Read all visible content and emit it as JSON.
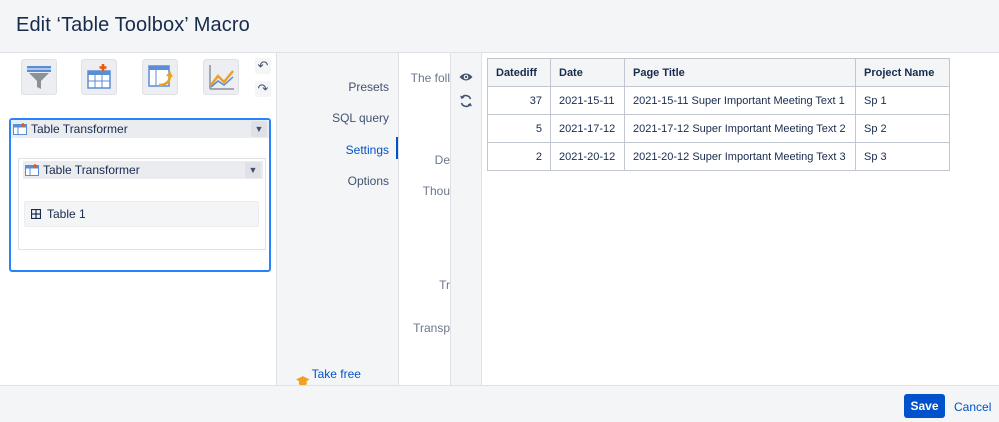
{
  "dialog": {
    "title": "Edit ‘Table Toolbox’ Macro"
  },
  "toolbar": {
    "tools": [
      {
        "icon": "filter-funnel-icon"
      },
      {
        "icon": "table-add-icon"
      },
      {
        "icon": "table-pivot-icon"
      },
      {
        "icon": "chart-line-icon"
      }
    ],
    "undo_icon": "undo-icon",
    "redo_icon": "redo-icon"
  },
  "macro_tree": {
    "outer_label": "Table Transformer",
    "inner_label": "Table Transformer",
    "table_label": "Table 1"
  },
  "nav": {
    "items": [
      "Presets",
      "SQL query",
      "Settings",
      "Options"
    ],
    "active": "Settings",
    "course_link": "Take free course"
  },
  "settings_fragments": [
    "The foll",
    "De",
    "Thou",
    "Tr",
    "Transp"
  ],
  "preview_controls": {
    "preview_icon": "eye-icon",
    "refresh_icon": "refresh-icon"
  },
  "preview_table": {
    "columns": [
      "Datediff",
      "Date",
      "Page Title",
      "Project Name"
    ],
    "rows": [
      [
        "37",
        "2021-15-11",
        "2021-15-11 Super Important Meeting Text 1",
        "Sp 1"
      ],
      [
        "5",
        "2021-17-12",
        "2021-17-12 Super Important Meeting Text 2",
        "Sp 2"
      ],
      [
        "2",
        "2021-20-12",
        "2021-20-12 Super Important Meeting Text 3",
        "Sp 3"
      ]
    ]
  },
  "footer": {
    "save_label": "Save",
    "cancel_label": "Cancel"
  },
  "colors": {
    "accent": "#0052cc",
    "selection_border": "#2684ff"
  }
}
